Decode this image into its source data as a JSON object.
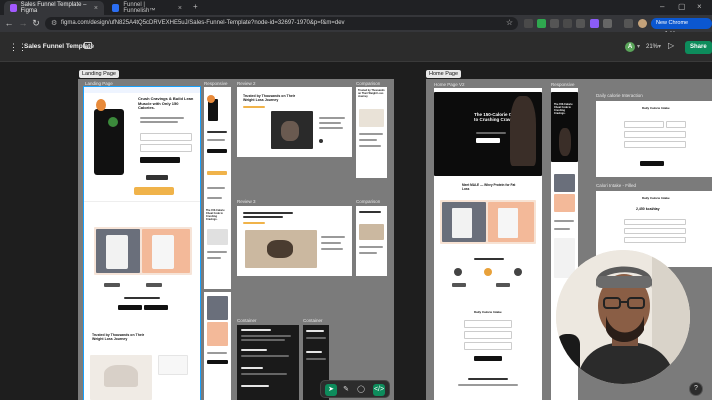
{
  "browser": {
    "tabs": [
      {
        "title": "Sales Funnel Template – Figma",
        "active": true
      },
      {
        "title": "Funnel | Funnelish™",
        "active": false
      }
    ],
    "url": "figma.com/design/ufN825A4tQ5cDRVEXHE5uJ/Sales-Funnel-Template?node-id=32697-1970&p=f&m=dev",
    "update_label": "New Chrome available"
  },
  "figma": {
    "file_name": "Sales Funnel Template",
    "avatar_initial": "A",
    "zoom": "21%",
    "share_label": "Share"
  },
  "canvas": {
    "sections": [
      {
        "label": "Landing Page"
      },
      {
        "label": "Home Page"
      }
    ],
    "frame_labels": {
      "landing": "Landing Page",
      "content": "Content",
      "responsive": "Responsive",
      "review2": "Review 2",
      "comparison1": "Comparison",
      "review3": "Review 3",
      "comparison2": "Comparison",
      "container1": "Container",
      "container2": "Container",
      "homev2": "Home Page V2",
      "responsive2": "Responsive",
      "daily_calorie": "Daily calorie Interaction",
      "calorie_intake": "Calori Intake - Filled"
    },
    "texts": {
      "landing_hero": "Crush Cravings & Build Lean Muscle with Only 150 Calories.",
      "trusted_1": "Trusted by Thousands on Their Weight Loss Journey",
      "trusted_2": "Trusted by Thousands on Their Weight Loss Journey",
      "trusted_3": "Trusted by Thousands on Their Weight Loss Journey",
      "hero_150": "The 150-Calorie Cheat Code to Crushing Cravings.",
      "hero_150_small": "The 150-Calorie Cheat Code to Crushing Cravings.",
      "meet_male": "Meet MALE — Whey Protein for Fat Loss",
      "daily_intake": "Daily Calorie Intake",
      "daily_intake_2": "Daily Calorie Intake",
      "daily_intake_3": "Daily Calorie Intake",
      "calories_value": "2,450 kcal/day"
    }
  },
  "icons": {
    "menu": "figma-menu-icon",
    "present": "play-icon",
    "help": "question-icon"
  },
  "colors": {
    "figma_green": "#0d8c5c",
    "chrome_blue": "#0b57d0",
    "section_gray": "#7b7b7b",
    "accent_peach": "#f5c9a8",
    "accent_orange": "#e8a13a"
  }
}
